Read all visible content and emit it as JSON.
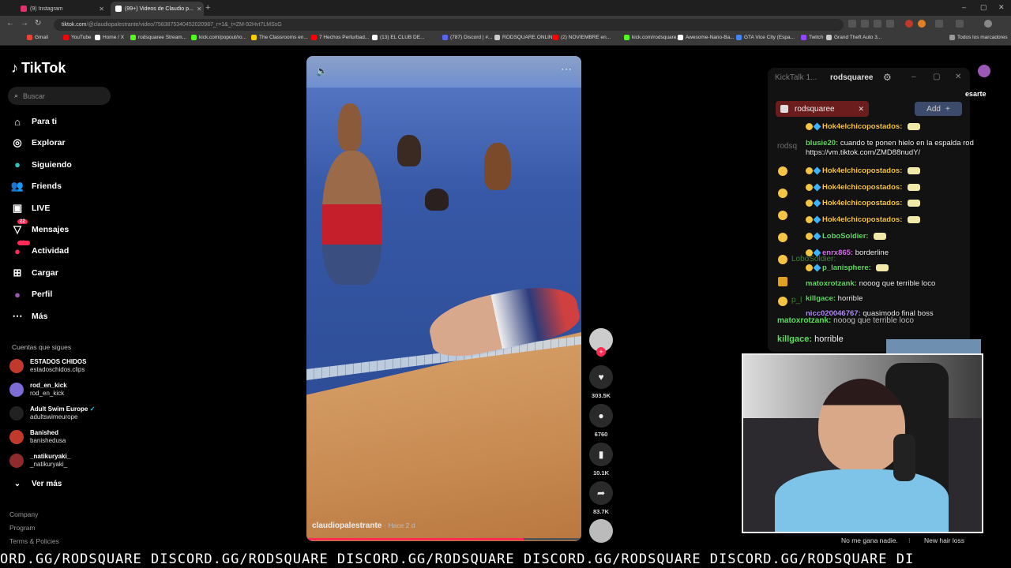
{
  "browser": {
    "tabs": [
      {
        "title": "(9) Instagram",
        "color": "#e1306c",
        "active": false
      },
      {
        "title": "(99+) Videos de Claudio p...",
        "color": "#ffffff",
        "active": true
      }
    ],
    "new_tab": "+",
    "window_controls": [
      "–",
      "▢",
      "✕"
    ],
    "url": "tiktok.com",
    "url_path": "/@claudiopalestrante/video/7583875340452020987_r=1&_t=ZM-92Hvt7LMSsG",
    "bookmarks": [
      {
        "label": "Gmail",
        "color": "#ea4335"
      },
      {
        "label": "YouTube",
        "color": "#ff0000"
      },
      {
        "label": "Home / X",
        "color": "#ffffff"
      },
      {
        "label": "rodsquaree Stream...",
        "color": "#53fc18"
      },
      {
        "label": "kick.com/popout/ro...",
        "color": "#53fc18"
      },
      {
        "label": "The Classrooms en...",
        "color": "#ffcc00"
      },
      {
        "label": "7 Hechos Perturbad...",
        "color": "#ff0000"
      },
      {
        "label": "(13) EL CLUB DE...",
        "color": "#ffffff"
      },
      {
        "label": "(787) Discord | #...",
        "color": "#5865f2"
      },
      {
        "label": "RODSQUARE.ONLINE",
        "color": "#cccccc"
      },
      {
        "label": "(2) NOVIEMBRE en...",
        "color": "#ff0000"
      },
      {
        "label": "kick.com/rodsquare...",
        "color": "#53fc18"
      },
      {
        "label": "Awesome-Nano-Ba...",
        "color": "#ffffff"
      },
      {
        "label": "GTA Vice City (Espa...",
        "color": "#4285f4"
      },
      {
        "label": "Twitch",
        "color": "#9146ff"
      },
      {
        "label": "Grand Theft Auto 3...",
        "color": "#cccccc"
      }
    ],
    "all_bookmarks": "Todos los marcadores"
  },
  "tiktok": {
    "logo": "TikTok",
    "search_placeholder": "Buscar",
    "nav": [
      {
        "label": "Para ti",
        "icon": "home-icon"
      },
      {
        "label": "Explorar",
        "icon": "compass-icon"
      },
      {
        "label": "Siguiendo",
        "icon": "following-icon"
      },
      {
        "label": "Friends",
        "icon": "friends-icon"
      },
      {
        "label": "LIVE",
        "icon": "live-icon"
      },
      {
        "label": "Mensajes",
        "icon": "messages-icon",
        "badge": "22"
      },
      {
        "label": "Actividad",
        "icon": "activity-icon",
        "badge": "99+"
      },
      {
        "label": "Cargar",
        "icon": "upload-icon"
      },
      {
        "label": "Perfil",
        "icon": "profile-icon"
      },
      {
        "label": "Más",
        "icon": "more-icon"
      }
    ],
    "following_title": "Cuentas que sigues",
    "following": [
      {
        "name": "ESTADOS CHIDOS",
        "handle": "estadoschidos.clips",
        "color": "#c0392b"
      },
      {
        "name": "rod_en_kick",
        "handle": "rod_en_kick",
        "color": "#7d6bd6"
      },
      {
        "name": "Adult Swim Europe",
        "handle": "adultswimeurope",
        "color": "#222222",
        "verified": true
      },
      {
        "name": "Banished",
        "handle": "banishedusa",
        "color": "#c0392b"
      },
      {
        "name": "_natikuryaki_",
        "handle": "_natikuryaki_",
        "color": "#8e2b2b"
      }
    ],
    "see_more": "Ver más",
    "footer": [
      "Company",
      "Program",
      "Terms & Policies"
    ]
  },
  "video": {
    "author": "claudiopalestrante",
    "time": "· Hace 2 d",
    "progress": 0.79,
    "likes": "303.5K",
    "comments": "6760",
    "saves": "10.1K",
    "shares": "83.7K"
  },
  "kicktalk": {
    "title": "KickTalk 1...",
    "channel": "rodsquaree",
    "chip": "rodsquaree",
    "add": "Add",
    "side_label": "esarte",
    "messages": [
      {
        "user": "Hok4elchicopostados:",
        "text": "",
        "color": "#f5c542"
      },
      {
        "user": "blusie20:",
        "text": "cuando te ponen hielo en la espalda rod https://vm.tiktok.com/ZMD88nudY/",
        "color": "#5ddc5d"
      },
      {
        "user": "Hok4elchicopostados:",
        "text": "",
        "color": "#f5c542"
      },
      {
        "user": "Hok4elchicopostados:",
        "text": "",
        "color": "#f5c542"
      },
      {
        "user": "Hok4elchicopostados:",
        "text": "",
        "color": "#f5c542"
      },
      {
        "user": "Hok4elchicopostados:",
        "text": "",
        "color": "#f5c542"
      },
      {
        "user": "LoboSoldier:",
        "text": "",
        "color": "#5ddc5d"
      },
      {
        "user": "enrx865:",
        "text": "borderline",
        "color": "#d96cf0"
      },
      {
        "user": "p_lanisphere:",
        "text": "",
        "color": "#5ddc5d"
      },
      {
        "user": "matoxrotzank:",
        "text": "nooog que terrible loco",
        "color": "#5ddc5d"
      },
      {
        "user": "killgace:",
        "text": "horrible",
        "color": "#5ddc5d"
      },
      {
        "user": "nicc020046767:",
        "text": "quasimodo final boss",
        "color": "#b48cff"
      }
    ],
    "ghost_lines": [
      {
        "text": "rodsq",
        "user": "",
        "color": "#cccccc"
      },
      {
        "text": "",
        "user": "LoboSoldier:",
        "color": "#5ddc5d"
      },
      {
        "text": "",
        "user": "p_l",
        "color": "#5ddc5d"
      },
      {
        "text": "nooog que terrible loco",
        "user": "matoxrotzank:",
        "color": "#5ddc5d"
      },
      {
        "text": "horrible",
        "user": "killgace:",
        "color": "#5ddc5d"
      }
    ]
  },
  "overlay": {
    "bottom_left": "No me gana nadie.",
    "bottom_right": "New hair loss",
    "ticker": "ORD.GG/RODSQUARE DISCORD.GG/RODSQUARE DISCORD.GG/RODSQUARE DISCORD.GG/RODSQUARE DISCORD.GG/RODSQUARE DI"
  }
}
